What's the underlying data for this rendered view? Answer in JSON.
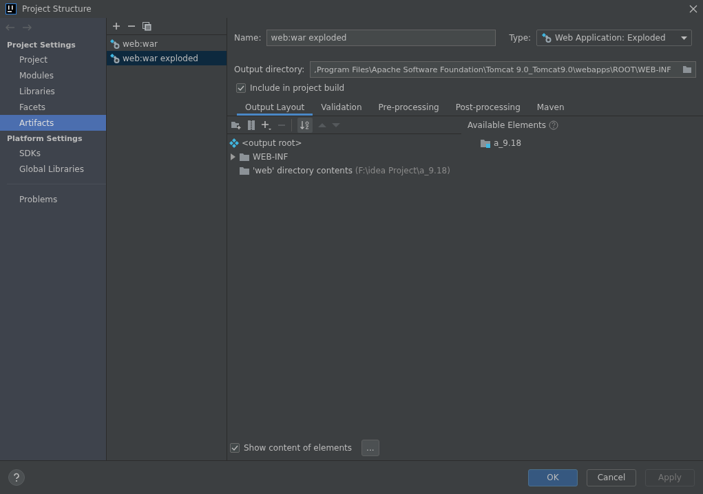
{
  "window": {
    "title": "Project Structure"
  },
  "sidebar": {
    "sections": [
      {
        "title": "Project Settings",
        "items": [
          {
            "label": "Project",
            "selected": false
          },
          {
            "label": "Modules",
            "selected": false
          },
          {
            "label": "Libraries",
            "selected": false
          },
          {
            "label": "Facets",
            "selected": false
          },
          {
            "label": "Artifacts",
            "selected": true
          }
        ]
      },
      {
        "title": "Platform Settings",
        "items": [
          {
            "label": "SDKs",
            "selected": false
          },
          {
            "label": "Global Libraries",
            "selected": false
          }
        ]
      }
    ],
    "footer_items": [
      {
        "label": "Problems",
        "selected": false
      }
    ]
  },
  "artifacts": [
    {
      "label": "web:war",
      "selected": false
    },
    {
      "label": "web:war exploded",
      "selected": true
    }
  ],
  "form": {
    "name": {
      "label": "Name:",
      "value": "web:war exploded"
    },
    "type": {
      "label": "Type:",
      "value": "Web Application: Exploded"
    },
    "output_directory": {
      "label": "Output directory:",
      "value": ",Program Files\\Apache Software Foundation\\Tomcat 9.0_Tomcat9.0\\webapps\\ROOT\\WEB-INF"
    },
    "include_in_build": {
      "label": "Include in project build",
      "checked": true
    }
  },
  "tabs": [
    {
      "label": "Output Layout",
      "selected": true
    },
    {
      "label": "Validation",
      "selected": false
    },
    {
      "label": "Pre-processing",
      "selected": false
    },
    {
      "label": "Post-processing",
      "selected": false
    },
    {
      "label": "Maven",
      "selected": false
    }
  ],
  "layout_tree": [
    {
      "kind": "root",
      "label": "<output root>"
    },
    {
      "kind": "folder",
      "label": "WEB-INF",
      "expanded": false
    },
    {
      "kind": "contents",
      "label": "'web' directory contents",
      "detail": "(F:\\idea Project\\a_9.18)"
    }
  ],
  "available": {
    "title": "Available Elements",
    "items": [
      {
        "label": "a_9.18"
      }
    ]
  },
  "show_content": {
    "label": "Show content of elements",
    "checked": true
  },
  "more_button": "...",
  "buttons": [
    {
      "label": "OK",
      "kind": "primary",
      "disabled": false
    },
    {
      "label": "Cancel",
      "kind": "normal",
      "disabled": false
    },
    {
      "label": "Apply",
      "kind": "normal",
      "disabled": true
    }
  ]
}
